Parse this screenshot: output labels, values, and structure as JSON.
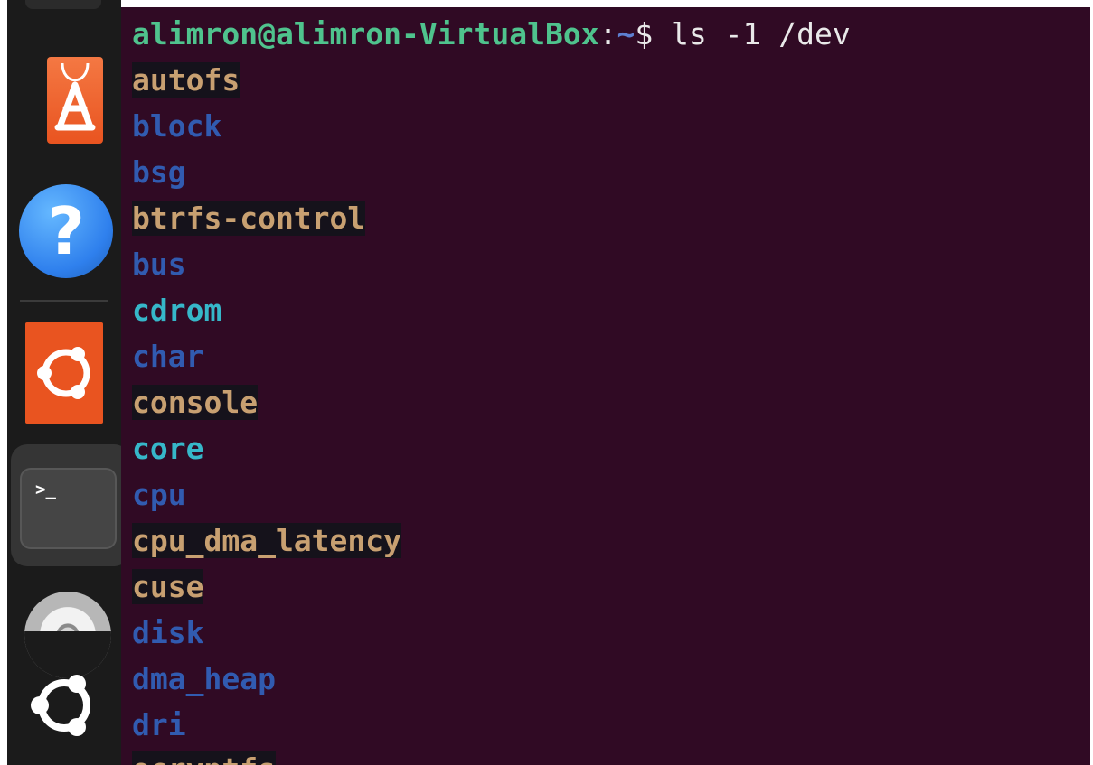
{
  "dock": {
    "apps": [
      {
        "icon": "software-store-icon"
      },
      {
        "icon": "help-icon",
        "glyph": "?"
      },
      {
        "icon": "ubuntu-software-icon"
      },
      {
        "icon": "terminal-icon",
        "glyph": ">_"
      },
      {
        "icon": "cd-drive-icon"
      },
      {
        "icon": "ubuntu-logo-icon"
      }
    ]
  },
  "terminal": {
    "prompt": {
      "user_host": "alimron@alimron-VirtualBox",
      "colon": ":",
      "path": "~",
      "symbol": "$",
      "command": " ls -1 /dev"
    },
    "entries": [
      {
        "name": "autofs",
        "kind": "file"
      },
      {
        "name": "block",
        "kind": "directory"
      },
      {
        "name": "bsg",
        "kind": "directory"
      },
      {
        "name": "btrfs-control",
        "kind": "file"
      },
      {
        "name": "bus",
        "kind": "directory"
      },
      {
        "name": "cdrom",
        "kind": "link"
      },
      {
        "name": "char",
        "kind": "directory"
      },
      {
        "name": "console",
        "kind": "file"
      },
      {
        "name": "core",
        "kind": "link"
      },
      {
        "name": "cpu",
        "kind": "directory"
      },
      {
        "name": "cpu_dma_latency",
        "kind": "file"
      },
      {
        "name": "cuse",
        "kind": "file"
      },
      {
        "name": "disk",
        "kind": "directory"
      },
      {
        "name": "dma_heap",
        "kind": "directory"
      },
      {
        "name": "dri",
        "kind": "directory"
      },
      {
        "name": "ecryptfs",
        "kind": "file"
      }
    ]
  },
  "colors": {
    "terminal_background": "#300a24",
    "prompt_user_host": "#4fc38d",
    "prompt_path": "#5d7fd0",
    "file_text": "#c8a071",
    "directory_text": "#315bb0",
    "link_text": "#36b7c9",
    "ubuntu_orange": "#e95420"
  }
}
